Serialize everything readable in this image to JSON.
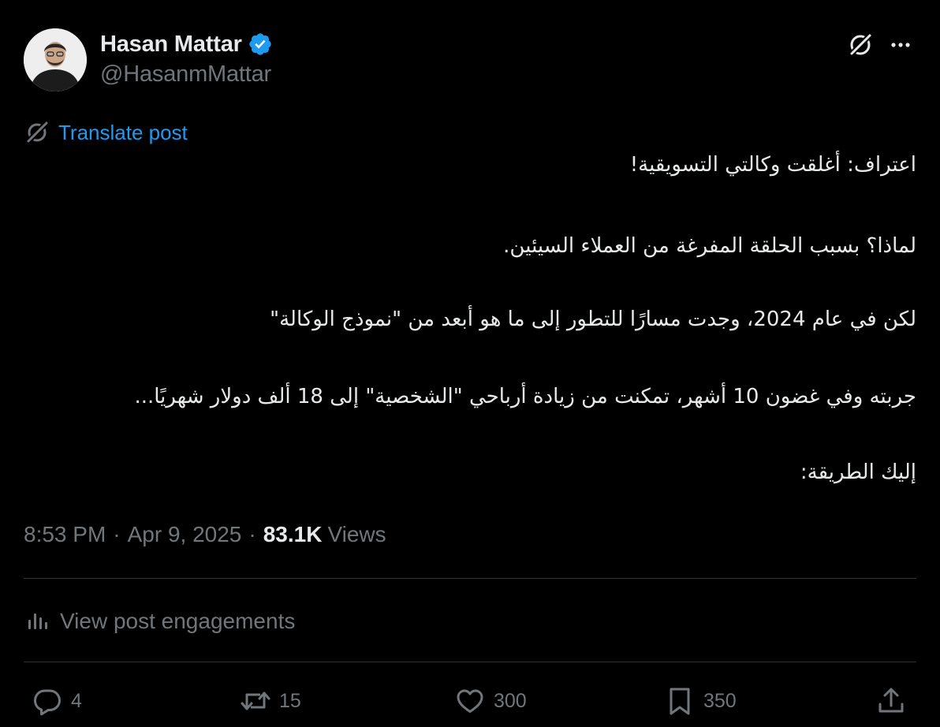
{
  "author": {
    "display_name": "Hasan Mattar",
    "handle": "@HasanmMattar",
    "verified": true,
    "badge_color": "#1d9bf0"
  },
  "header_icons": [
    "grok-icon",
    "more-icon"
  ],
  "translate": {
    "label": "Translate post",
    "icon": "translate-icon"
  },
  "post": {
    "lines": [
      "اعتراف: أغلقت وكالتي التسويقية!",
      "لماذا؟ بسبب الحلقة المفرغة من العملاء السيئين.",
      "لكن في عام 2024، وجدت مسارًا للتطور إلى ما هو أبعد من \"نموذج الوكالة\"",
      "جربته وفي غضون 10 أشهر، تمكنت من زيادة أرباحي \"الشخصية\" إلى 18 ألف دولار شهريًا...",
      "إليك الطريقة:"
    ]
  },
  "meta": {
    "time": "8:53 PM",
    "separator": "·",
    "date": "Apr 9, 2025",
    "views_count": "83.1K",
    "views_label": "Views"
  },
  "engagements": {
    "label": "View post engagements",
    "icon": "analytics-icon"
  },
  "actions": {
    "reply_count": "4",
    "repost_count": "15",
    "like_count": "300",
    "bookmark_count": "350"
  },
  "colors": {
    "background": "#000000",
    "primary_text": "#e7e9ea",
    "secondary_text": "#71767b",
    "link": "#1d9bf0",
    "divider": "#2f3336"
  }
}
